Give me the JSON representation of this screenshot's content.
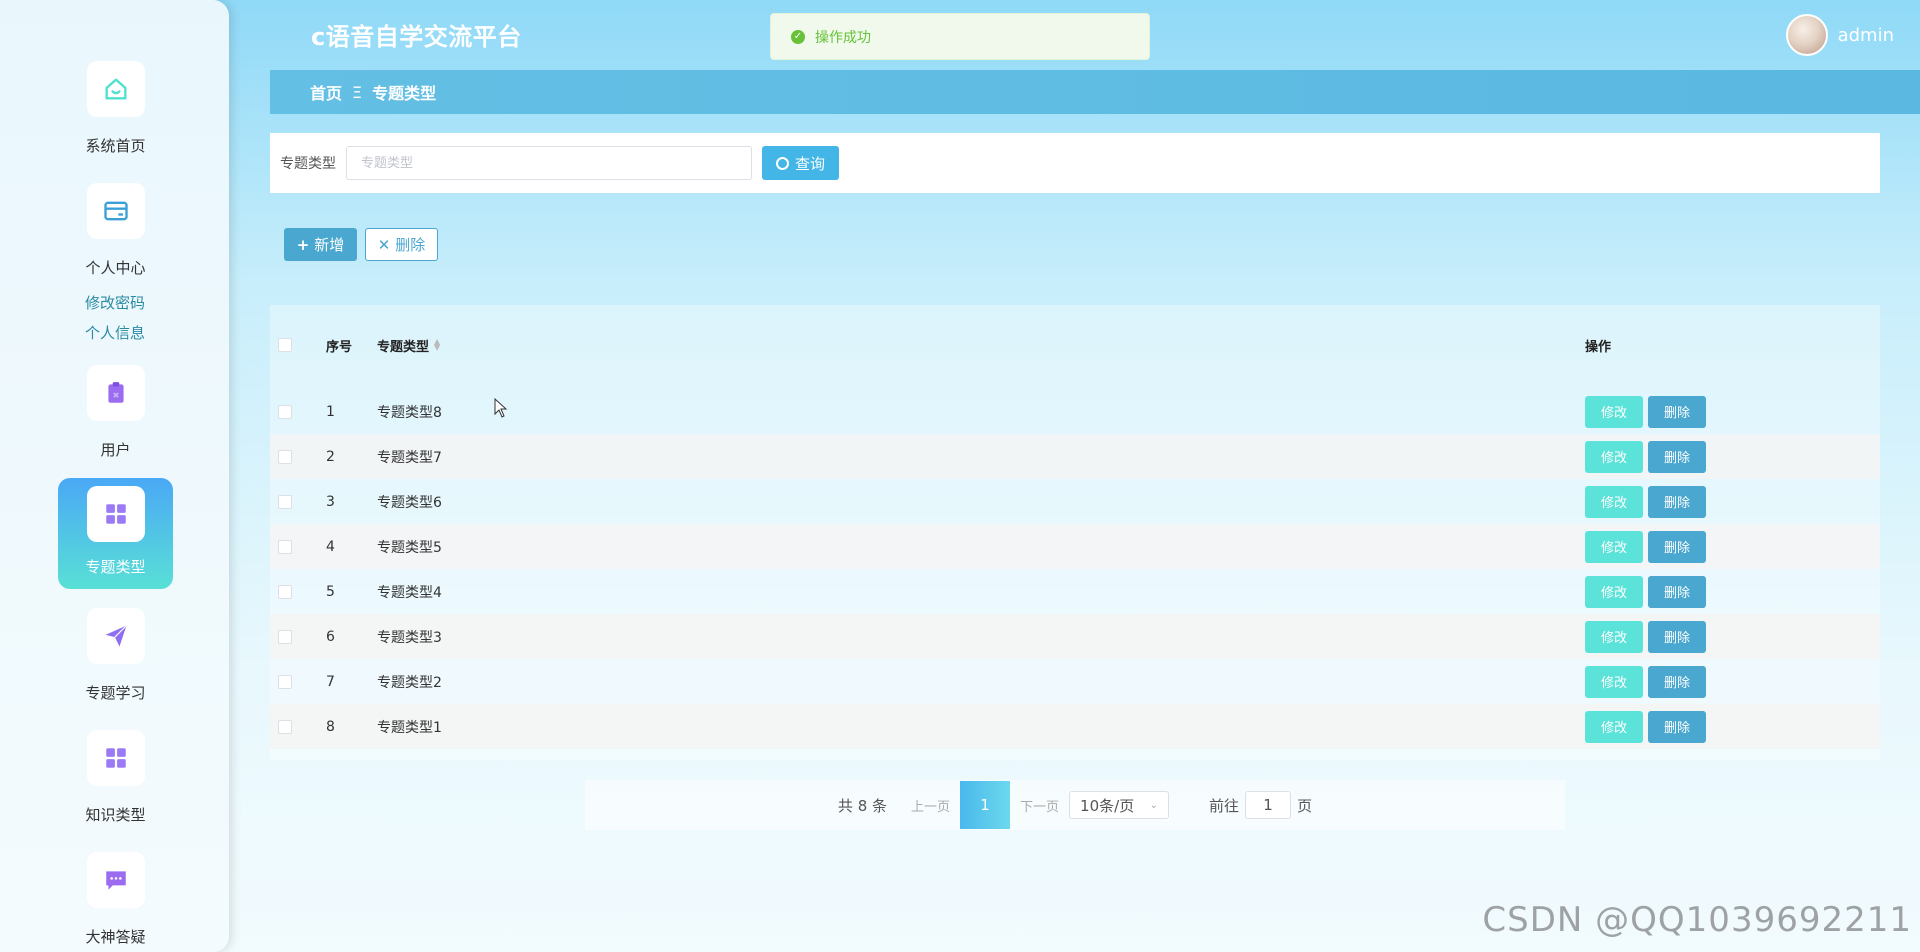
{
  "app": {
    "title": "c语音自学交流平台",
    "username": "admin"
  },
  "toast": {
    "message": "操作成功"
  },
  "breadcrumb": {
    "home": "首页",
    "separator": "Ξ",
    "current": "专题类型"
  },
  "sidebar": {
    "items": [
      {
        "label": "系统首页",
        "icon": "home-icon"
      },
      {
        "label": "个人中心",
        "icon": "card-icon"
      },
      {
        "label": "用户",
        "icon": "clipboard-icon"
      },
      {
        "label": "专题类型",
        "icon": "grid-icon",
        "active": true
      },
      {
        "label": "专题学习",
        "icon": "paper-plane-icon"
      },
      {
        "label": "知识类型",
        "icon": "grid-icon"
      },
      {
        "label": "大神答疑",
        "icon": "chat-icon"
      }
    ],
    "sub_links": [
      "修改密码",
      "个人信息"
    ]
  },
  "search": {
    "label": "专题类型",
    "placeholder": "专题类型",
    "button": "查询"
  },
  "actions": {
    "add": "新增",
    "delete": "删除"
  },
  "table": {
    "headers": {
      "no": "序号",
      "type": "专题类型",
      "ops": "操作"
    },
    "rows": [
      {
        "no": "1",
        "type": "专题类型8"
      },
      {
        "no": "2",
        "type": "专题类型7"
      },
      {
        "no": "3",
        "type": "专题类型6"
      },
      {
        "no": "4",
        "type": "专题类型5"
      },
      {
        "no": "5",
        "type": "专题类型4"
      },
      {
        "no": "6",
        "type": "专题类型3"
      },
      {
        "no": "7",
        "type": "专题类型2"
      },
      {
        "no": "8",
        "type": "专题类型1"
      }
    ],
    "edit_label": "修改",
    "delete_label": "删除"
  },
  "pagination": {
    "total": "共 8 条",
    "prev": "上一页",
    "current": "1",
    "next": "下一页",
    "page_size": "10条/页",
    "goto_prefix": "前往",
    "goto_value": "1",
    "goto_suffix": "页"
  },
  "watermark": "CSDN @QQ1039692211",
  "colors": {
    "accent": "#43b6e7",
    "edit_button": "#5ce3d9",
    "delete_button": "#4aa7cf",
    "success": "#67c23a"
  }
}
